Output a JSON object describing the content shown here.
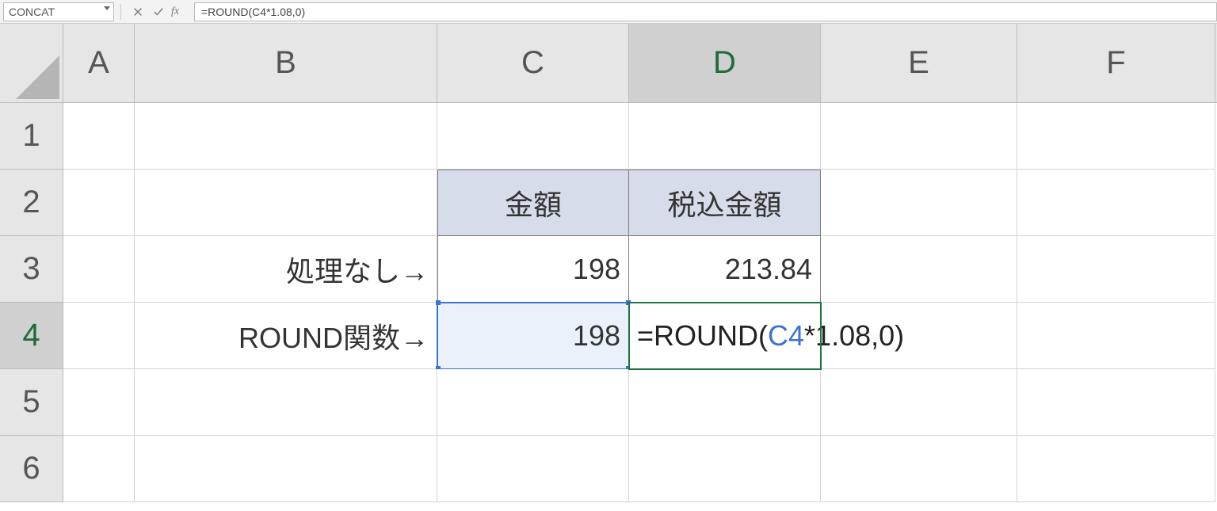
{
  "formula_bar": {
    "name_box": "CONCAT",
    "formula": "=ROUND(C4*1.08,0)"
  },
  "columns": [
    "A",
    "B",
    "C",
    "D",
    "E",
    "F"
  ],
  "active_column": "D",
  "rows": [
    "1",
    "2",
    "3",
    "4",
    "5",
    "6"
  ],
  "active_row": "4",
  "cells": {
    "C2": "金額",
    "D2": "税込金額",
    "B3": "処理なし→",
    "C3": "198",
    "D3": "213.84",
    "B4": "ROUND関数→",
    "C4": "198",
    "D4_prefix": "=ROUND(",
    "D4_ref": "C4",
    "D4_suffix": "*1.08,0)"
  }
}
